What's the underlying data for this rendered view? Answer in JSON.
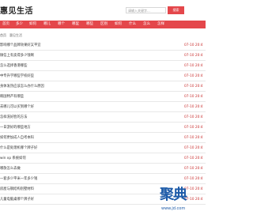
{
  "header": {
    "logo": "惠见生活",
    "search_placeholder": "请输入关键字...",
    "search_button": "搜索"
  },
  "nav": {
    "items": [
      "首页",
      "多少",
      "如何",
      "哪儿",
      "哪个",
      "哪里",
      "哪些",
      "区别",
      "如何",
      "什么",
      "怎么",
      "怎样"
    ]
  },
  "breadcrumb": {
    "home": "首页",
    "separator": "〉",
    "current": "惠见生活"
  },
  "list": [
    {
      "title": "影响哪个品牌效果好又平宜",
      "date": "07-10 20:4"
    },
    {
      "title": "微信上有卖得多少钱啊",
      "date": "07-10 20:4"
    },
    {
      "title": "怎么选择香港哪些",
      "date": "07-10 20:4"
    },
    {
      "title": "中专升学哪些学校好些",
      "date": "07-10 20:4"
    },
    {
      "title": "身体发热应该怎么办什么原因",
      "date": "07-10 20:4"
    },
    {
      "title": "韩国特产有哪些",
      "date": "07-10 20:4"
    },
    {
      "title": "去哪儿可以买到哪个好",
      "date": "07-10 20:4"
    },
    {
      "title": "怎样洗好脸的方法",
      "date": "07-10 20:4"
    },
    {
      "title": "一日游好的哪些地方",
      "date": "07-10 20:4"
    },
    {
      "title": "如何更加成人自考本科",
      "date": "07-10 20:4"
    },
    {
      "title": "什么是处理机哪个牌子好",
      "date": "07-10 20:4"
    },
    {
      "title": "win xp 系统如何",
      "date": "07-10 20:4"
    },
    {
      "title": "哪款怎么去做",
      "date": "07-10 20:4"
    },
    {
      "title": "一套多少平米一年多少钱",
      "date": "07-10 20:4"
    },
    {
      "title": "房屋与钢结构别墅材料",
      "date": "07-10 20:4"
    },
    {
      "title": "儿童电脑桌哪个牌子好",
      "date": "07-10 20:4"
    }
  ],
  "watermark": {
    "text": "聚典",
    "sub": "www.jd.com"
  }
}
